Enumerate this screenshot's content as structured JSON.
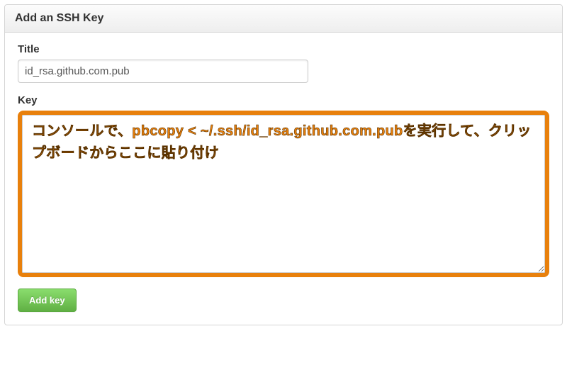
{
  "panel": {
    "header_title": "Add an SSH Key"
  },
  "form": {
    "title_label": "Title",
    "title_value": "id_rsa.github.com.pub",
    "key_label": "Key",
    "key_value": "",
    "submit_label": "Add key"
  },
  "annotation": {
    "text": "コンソールで、pbcopy < ~/.ssh/id_rsa.github.com.pubを実行して、クリップボードからここに貼り付け",
    "highlight_color": "#e8800c"
  }
}
